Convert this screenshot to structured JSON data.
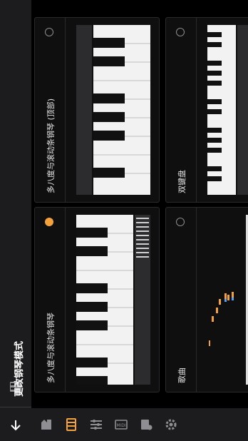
{
  "screen": {
    "title": "更改钢琴模式"
  },
  "nav": {
    "back_icon": "arrow-back-icon",
    "tabs": [
      {
        "icon": "piano-hand-icon",
        "active": false
      },
      {
        "icon": "keyboard-mode-icon",
        "active": true
      },
      {
        "icon": "sliders-icon",
        "active": false
      },
      {
        "icon": "midi-icon",
        "active": false
      },
      {
        "icon": "record-icon",
        "active": false
      },
      {
        "icon": "gear-icon",
        "active": false
      }
    ]
  },
  "modes": [
    {
      "label": "多八度与滚动条钢琴",
      "selected": true
    },
    {
      "label": "多八度与滚动条钢琴 (顶部)",
      "selected": false
    },
    {
      "label": "歌曲",
      "selected": false
    },
    {
      "label": "双键盘",
      "selected": false
    }
  ],
  "colors": {
    "accent": "#f4a13c",
    "background": "#000000",
    "rail": "#1c1c1e"
  }
}
